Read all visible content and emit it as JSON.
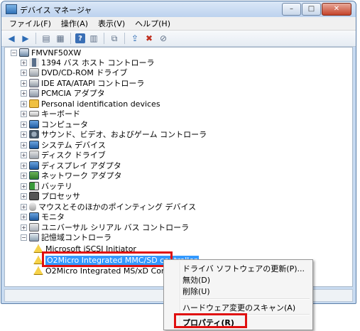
{
  "window": {
    "title": "デバイス マネージャ"
  },
  "menubar": {
    "items": [
      "ファイル(F)",
      "操作(A)",
      "表示(V)",
      "ヘルプ(H)"
    ]
  },
  "tree": {
    "root": "FMVNF50XW",
    "categories": [
      "1394 バス ホスト コントローラ",
      "DVD/CD-ROM ドライブ",
      "IDE ATA/ATAPI コントローラ",
      "PCMCIA アダプタ",
      "Personal identification devices",
      "キーボード",
      "コンピュータ",
      "サウンド、ビデオ、およびゲーム コントローラ",
      "システム デバイス",
      "ディスク ドライブ",
      "ディスプレイ アダプタ",
      "ネットワーク アダプタ",
      "バッテリ",
      "プロセッサ",
      "マウスとそのほかのポインティング デバイス",
      "モニタ",
      "ユニバーサル シリアル バス コントローラ",
      "記憶域コントローラ"
    ],
    "storage_children": [
      "Microsoft iSCSI Initiator",
      "O2Micro Integrated MMC/SD controller",
      "O2Micro Integrated MS/xD Controller"
    ]
  },
  "context_menu": {
    "items": [
      "ドライバ ソフトウェアの更新(P)...",
      "無効(D)",
      "削除(U)",
      "ハードウェア変更のスキャン(A)",
      "プロパティ(R)"
    ]
  },
  "colors": {
    "selection": "#3399ff",
    "highlight_box": "#e01010"
  }
}
